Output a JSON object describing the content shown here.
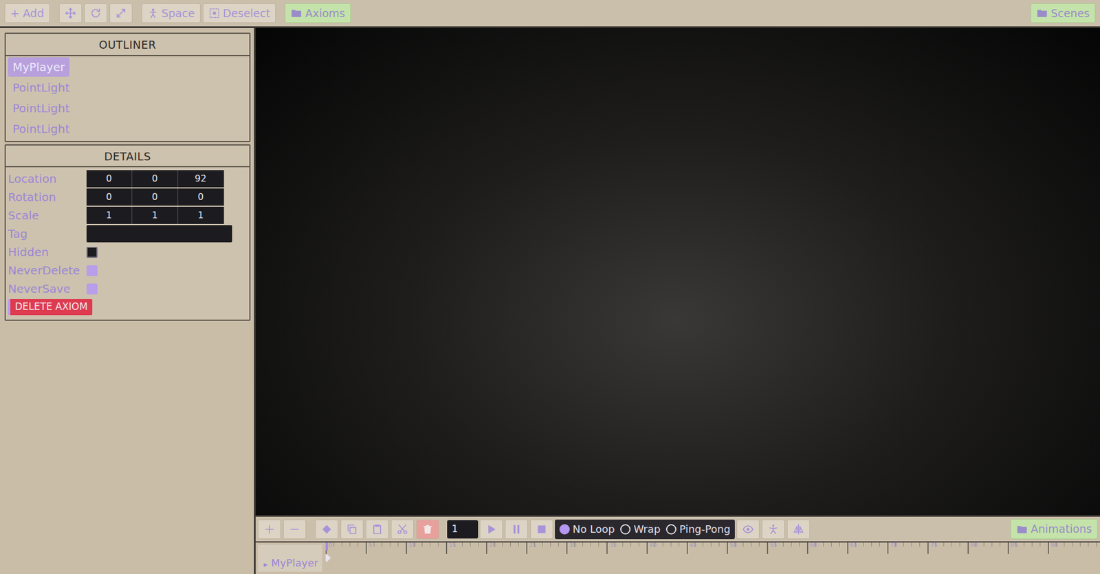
{
  "toolbar": {
    "buttons": [
      {
        "kind": "text",
        "label": "+ Add"
      },
      {
        "kind": "icon"
      },
      {
        "kind": "icon"
      },
      {
        "kind": "icon"
      },
      {
        "kind": "text",
        "label": "Space"
      },
      {
        "kind": "text",
        "label": "Deselect"
      },
      {
        "kind": "folder",
        "label": "Axioms"
      }
    ],
    "right": {
      "kind": "folder",
      "label": "Scenes"
    }
  },
  "outliner": {
    "title": "OUTLINER",
    "items": [
      {
        "label": "MyPlayer",
        "selected": true
      },
      {
        "label": "PointLight",
        "selected": false
      },
      {
        "label": "PointLight",
        "selected": false
      },
      {
        "label": "PointLight",
        "selected": false
      }
    ]
  },
  "details": {
    "title": "DETAILS",
    "fields": [
      {
        "kind": "vector",
        "label": "Location",
        "values": [
          "0",
          "0",
          "92"
        ]
      },
      {
        "kind": "vector",
        "label": "Rotation",
        "values": [
          "0",
          "0",
          "0"
        ]
      },
      {
        "kind": "vector",
        "label": "Scale",
        "values": [
          "1",
          "1",
          "1"
        ]
      },
      {
        "kind": "text",
        "label": "Tag"
      },
      {
        "kind": "checkbox",
        "label": "Hidden",
        "checked": false
      },
      {
        "kind": "checkbox",
        "label": "NeverDelete",
        "checked": true
      },
      {
        "kind": "checkbox",
        "label": "NeverSave",
        "checked": true
      }
    ],
    "delete_button": "DELETE AXIOM"
  },
  "timeline": {
    "edit_buttons": [
      {
        "kind": "add"
      },
      {
        "kind": "remove"
      },
      {
        "kind": "key"
      },
      {
        "kind": "copy"
      },
      {
        "kind": "paste"
      },
      {
        "kind": "cut"
      },
      {
        "kind": "delete"
      }
    ],
    "frame": "1",
    "transport": [
      {
        "kind": "play"
      },
      {
        "kind": "pause"
      },
      {
        "kind": "stop"
      }
    ],
    "loop_modes": [
      {
        "label": "No Loop",
        "selected": true
      },
      {
        "label": "Wrap",
        "selected": false
      },
      {
        "label": "Ping-Pong",
        "selected": false
      }
    ],
    "view_buttons": [
      {
        "kind": "eye"
      },
      {
        "kind": "skeleton"
      },
      {
        "kind": "mirror"
      }
    ],
    "animations": "Animations",
    "track": {
      "toggle": "▸",
      "name": "MyPlayer",
      "expanded": false
    },
    "ticks": [
      "0",
      "5",
      "10",
      "15",
      "20",
      "25",
      "30",
      "35",
      "40",
      "45",
      "50",
      "55",
      "60",
      "65",
      "70",
      "75",
      "80",
      "85",
      "90"
    ],
    "playhead": {
      "level": 0
    }
  }
}
